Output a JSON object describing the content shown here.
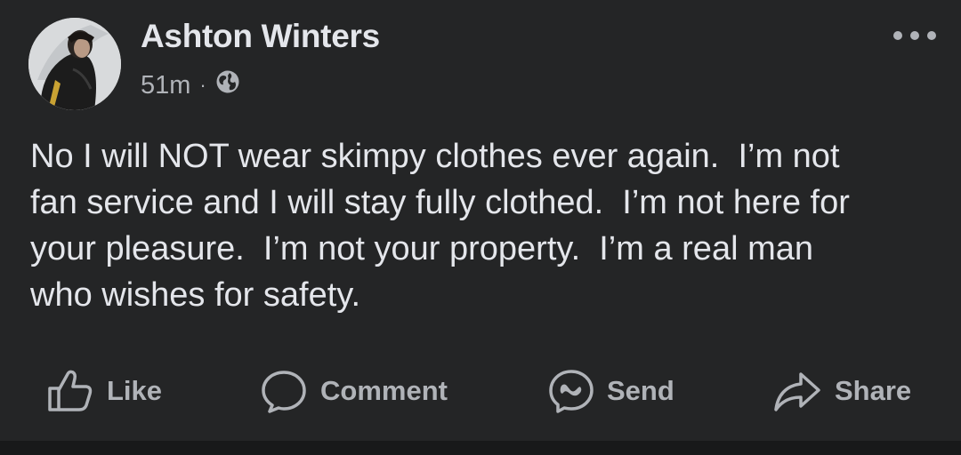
{
  "post": {
    "author": "Ashton Winters",
    "time": "51m",
    "separator": "·",
    "audience_icon": "globe-icon",
    "text": "No I will NOT wear skimpy clothes ever again.  I’m not\nfan service and I will stay fully clothed.  I’m not here for\nyour pleasure.  I’m not your property.  I’m a real man\nwho wishes for safety."
  },
  "actions": {
    "like": {
      "label": "Like",
      "icon": "thumbs-up-icon"
    },
    "comment": {
      "label": "Comment",
      "icon": "comment-bubble-icon"
    },
    "send": {
      "label": "Send",
      "icon": "messenger-icon"
    },
    "share": {
      "label": "Share",
      "icon": "share-arrow-icon"
    }
  },
  "colors": {
    "background": "#242526",
    "primary_text": "#e4e6eb",
    "secondary_text": "#b0b3b8"
  }
}
